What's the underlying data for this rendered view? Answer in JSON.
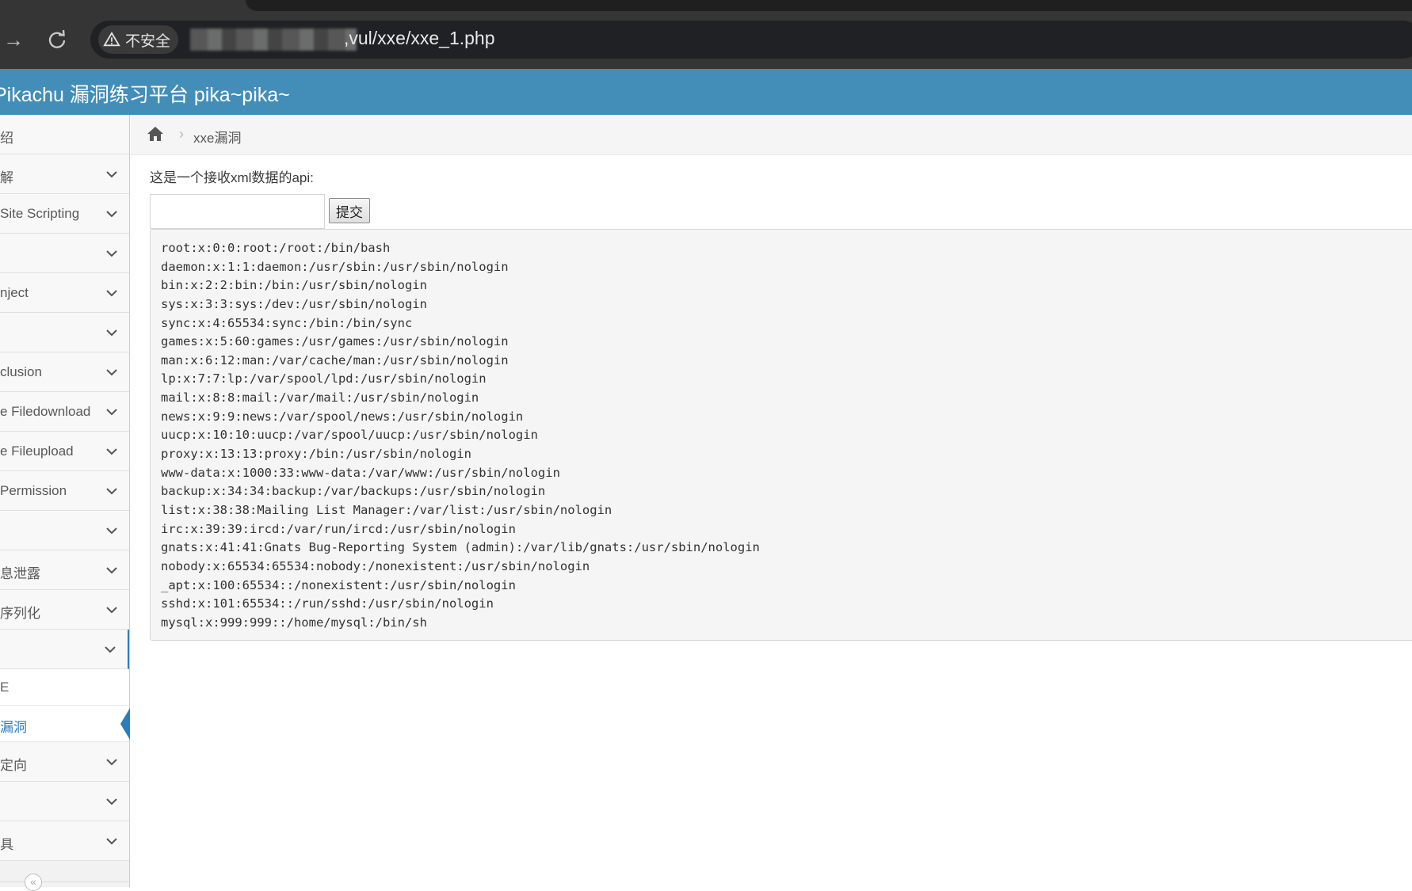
{
  "browser": {
    "security_label": "不安全",
    "url": ",vul/xxe/xxe_1.php"
  },
  "app": {
    "title": "Pikachu 漏洞练习平台 pika~pika~"
  },
  "sidebar": {
    "items": [
      {
        "label": "绍",
        "chevron": false
      },
      {
        "label": "解",
        "chevron": true
      },
      {
        "label": "Site Scripting",
        "chevron": true
      },
      {
        "label": "",
        "chevron": true
      },
      {
        "label": "nject",
        "chevron": true
      },
      {
        "label": "",
        "chevron": true
      },
      {
        "label": "clusion",
        "chevron": true
      },
      {
        "label": "e Filedownload",
        "chevron": true
      },
      {
        "label": "e Fileupload",
        "chevron": true
      },
      {
        "label": "Permission",
        "chevron": true
      },
      {
        "label": "",
        "chevron": true
      },
      {
        "label": "息泄露",
        "chevron": true
      },
      {
        "label": "序列化",
        "chevron": true
      },
      {
        "label": "",
        "chevron": true,
        "open": true
      }
    ],
    "subitems": [
      {
        "label": "E"
      },
      {
        "label": "漏洞",
        "active": true
      }
    ],
    "items_after": [
      {
        "label": "定向",
        "chevron": true
      },
      {
        "label": "",
        "chevron": true
      },
      {
        "label": "具",
        "chevron": true
      }
    ],
    "collapse_glyph": "«"
  },
  "breadcrumb": {
    "separator": "›",
    "current": "xxe漏洞"
  },
  "main": {
    "description": "这是一个接收xml数据的api:",
    "input_value": "",
    "submit_label": "提交",
    "output_lines": [
      "root:x:0:0:root:/root:/bin/bash",
      "daemon:x:1:1:daemon:/usr/sbin:/usr/sbin/nologin",
      "bin:x:2:2:bin:/bin:/usr/sbin/nologin",
      "sys:x:3:3:sys:/dev:/usr/sbin/nologin",
      "sync:x:4:65534:sync:/bin:/bin/sync",
      "games:x:5:60:games:/usr/games:/usr/sbin/nologin",
      "man:x:6:12:man:/var/cache/man:/usr/sbin/nologin",
      "lp:x:7:7:lp:/var/spool/lpd:/usr/sbin/nologin",
      "mail:x:8:8:mail:/var/mail:/usr/sbin/nologin",
      "news:x:9:9:news:/var/spool/news:/usr/sbin/nologin",
      "uucp:x:10:10:uucp:/var/spool/uucp:/usr/sbin/nologin",
      "proxy:x:13:13:proxy:/bin:/usr/sbin/nologin",
      "www-data:x:1000:33:www-data:/var/www:/usr/sbin/nologin",
      "backup:x:34:34:backup:/var/backups:/usr/sbin/nologin",
      "list:x:38:38:Mailing List Manager:/var/list:/usr/sbin/nologin",
      "irc:x:39:39:ircd:/var/run/ircd:/usr/sbin/nologin",
      "gnats:x:41:41:Gnats Bug-Reporting System (admin):/var/lib/gnats:/usr/sbin/nologin",
      "nobody:x:65534:65534:nobody:/nonexistent:/usr/sbin/nologin",
      "_apt:x:100:65534::/nonexistent:/usr/sbin/nologin",
      "sshd:x:101:65534::/run/sshd:/usr/sbin/nologin",
      "mysql:x:999:999::/home/mysql:/bin/sh"
    ]
  },
  "colors": {
    "header": "#438eb9",
    "accent": "#2b7dbc"
  }
}
